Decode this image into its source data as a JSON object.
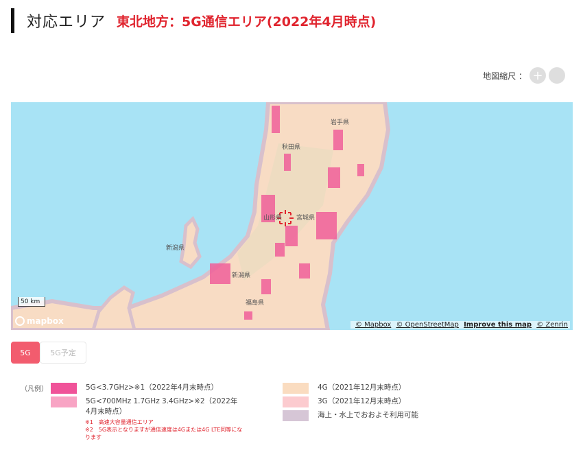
{
  "header": {
    "title": "対応エリア",
    "subtitle": "東北地方：5G通信エリア(2022年4月時点)"
  },
  "zoom": {
    "label": "地図縮尺 ：",
    "plus": "+",
    "minus": ""
  },
  "map": {
    "scale_label": "50 km",
    "logo_text": "mapbox",
    "attribution": {
      "mapbox": "© Mapbox",
      "osm": "© OpenStreetMap",
      "improve": "Improve this map",
      "zenrin": "© Zenrin"
    },
    "prefectures": {
      "iwate": "岩手県",
      "akita": "秋田県",
      "yamagata": "山形県",
      "miyagi": "宮城県",
      "niigata1": "新潟県",
      "niigata2": "新潟県",
      "fukushima": "福島県"
    },
    "colors": {
      "sea": "#a8e3f5",
      "land": "#f8dcc4",
      "coast": "#d8c0cc",
      "fiveg": "#f0609a"
    }
  },
  "tabs": {
    "active": "5G",
    "inactive": "5G予定"
  },
  "legend": {
    "label": "（凡例）",
    "items": [
      {
        "text": "5G<3.7GHz>※1（2022年4月末時点）",
        "color": "#f05399"
      },
      {
        "text": "5G<700MHz 1.7GHz 3.4GHz>※2（2022年4月末時点）",
        "color": "#f8a4c4"
      },
      {
        "text": "4G（2021年12月末時点）",
        "color": "#fadcc0"
      },
      {
        "text": "3G（2021年12月末時点）",
        "color": "#fccbcf"
      },
      {
        "text": "海上・水上でおおよそ利用可能",
        "color": "#d6c6d6"
      }
    ],
    "note1": "※1　高速大容量通信エリア",
    "note2": "※2　5G表示となりますが通信速度は4Gまたは4G LTE同等になります"
  }
}
